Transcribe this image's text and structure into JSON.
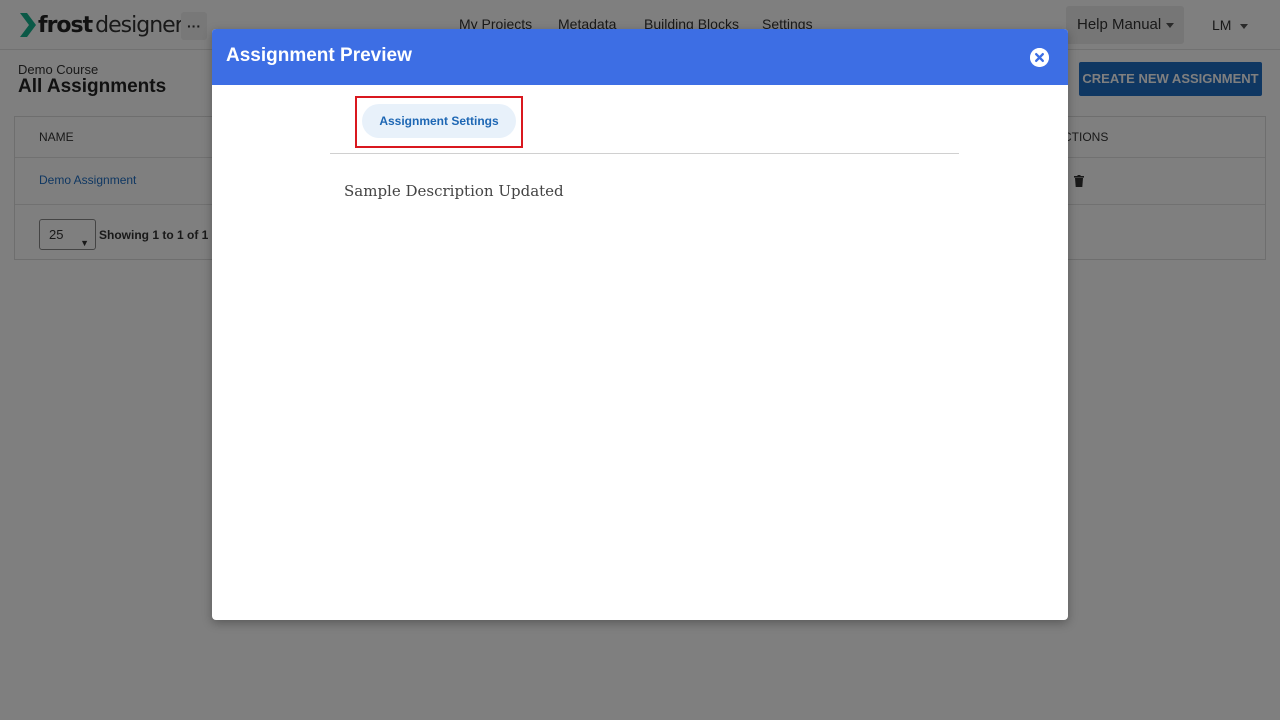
{
  "brand": {
    "logo_text_bold": "frost",
    "logo_text_light": "designer",
    "accent_color": "#1f6fc5",
    "logo_mark_color": "#16b28e"
  },
  "topnav": {
    "more_label": "···",
    "links": [
      "My Projects",
      "Metadata",
      "Building Blocks",
      "Settings"
    ],
    "help_label": "Help Manual",
    "user_label": "LM"
  },
  "page": {
    "breadcrumb": "Demo Course",
    "title": "All Assignments",
    "create_button": "CREATE NEW ASSIGNMENT"
  },
  "table": {
    "columns": [
      "NAME",
      "ACTIONS"
    ],
    "rows": [
      {
        "name": "Demo Assignment",
        "action_icon": "trash-icon"
      }
    ],
    "per_page": "25",
    "showing_text": "Showing 1 to 1 of 1"
  },
  "modal": {
    "title": "Assignment Preview",
    "close_icon": "close-circle-icon",
    "header_color": "#3d6ee4",
    "tabs": [
      {
        "label": "Assignment Settings",
        "highlighted": true
      }
    ],
    "description": "Sample Description Updated",
    "highlight_color": "#d9181f"
  }
}
